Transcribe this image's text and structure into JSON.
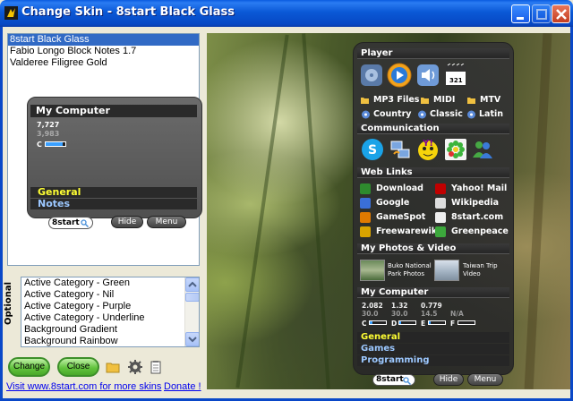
{
  "window": {
    "title": "Change Skin - 8start Black Glass"
  },
  "skins": {
    "items": [
      "8start Black Glass",
      "Fabio Longo Block Notes 1.7",
      "Valderee Filigree Gold"
    ],
    "selected_index": 0
  },
  "mini_preview": {
    "header": "My Computer",
    "num1": "7,727",
    "num2": "3,983",
    "drive_label": "C",
    "drive_fill_pct": 85,
    "categories": [
      "General",
      "Notes"
    ],
    "logo_text": "8start",
    "hide_label": "Hide",
    "menu_label": "Menu"
  },
  "optional": {
    "label": "Optional",
    "items": [
      "Active Category - Green",
      "Active Category - Nil",
      "Active Category - Purple",
      "Active Category - Underline",
      "Background Gradient",
      "Background Rainbow"
    ]
  },
  "buttons": {
    "change": "Change",
    "close": "Close"
  },
  "links": {
    "visit": "Visit www.8start.com for more skins",
    "donate": "Donate !"
  },
  "preview": {
    "player": {
      "header": "Player",
      "tiles": [
        "mp3-tile-icon",
        "media-player-icon",
        "speaker-icon",
        "tv-calendar-icon"
      ],
      "calendar_number": "321",
      "links": [
        {
          "label": "MP3 Files",
          "icon": "folder-icon"
        },
        {
          "label": "MIDI",
          "icon": "folder-icon"
        },
        {
          "label": "MTV",
          "icon": "folder-icon"
        },
        {
          "label": "Country",
          "icon": "radio-icon"
        },
        {
          "label": "Classic",
          "icon": "radio-icon"
        },
        {
          "label": "Latin",
          "icon": "radio-icon"
        }
      ]
    },
    "communication": {
      "header": "Communication",
      "tiles": [
        "skype-icon",
        "network-icon",
        "yahoo-messenger-icon",
        "icq-icon",
        "msn-messenger-icon"
      ]
    },
    "web_links": {
      "header": "Web Links",
      "items": [
        {
          "label": "Download",
          "icon": "download-icon",
          "color": "#2e8b2e"
        },
        {
          "label": "Yahoo! Mail",
          "icon": "yahoo-mail-icon",
          "color": "#c00000"
        },
        {
          "label": "Google",
          "icon": "google-icon",
          "color": "#3a6fd8"
        },
        {
          "label": "Wikipedia",
          "icon": "wikipedia-icon",
          "color": "#dddddd"
        },
        {
          "label": "GameSpot",
          "icon": "gamespot-icon",
          "color": "#e07a00"
        },
        {
          "label": "8start.com",
          "icon": "8start-icon",
          "color": "#eeeeee"
        },
        {
          "label": "Freewarewiki",
          "icon": "pencil-icon",
          "color": "#d9a400"
        },
        {
          "label": "Greenpeace",
          "icon": "greenpeace-icon",
          "color": "#3ca83c"
        }
      ]
    },
    "photos": {
      "header": "My Photos & Video",
      "items": [
        {
          "label_line1": "Buko National",
          "label_line2": "Park Photos"
        },
        {
          "label_line1": "Taiwan Trip",
          "label_line2": "Video"
        }
      ]
    },
    "computer": {
      "header": "My Computer",
      "drives": [
        {
          "top": "2.082",
          "bottom": "30.0",
          "letter": "C",
          "fill_pct": 15
        },
        {
          "top": "1.32",
          "bottom": "30.0",
          "letter": "D",
          "fill_pct": 10
        },
        {
          "top": "0.779",
          "bottom": "14.5",
          "letter": "E",
          "fill_pct": 10
        },
        {
          "top": "",
          "bottom": "N/A",
          "letter": "F",
          "fill_pct": 0
        }
      ]
    },
    "categories": [
      {
        "label": "General",
        "color": "#ffff33"
      },
      {
        "label": "Games",
        "color": "#9cc8ff"
      },
      {
        "label": "Programming",
        "color": "#9cc8ff"
      }
    ],
    "logo_text": "8start",
    "hide_label": "Hide",
    "menu_label": "Menu"
  }
}
